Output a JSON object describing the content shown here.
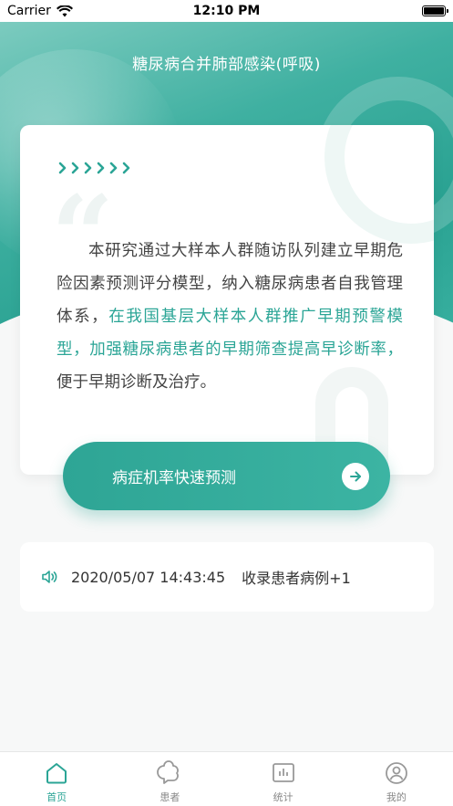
{
  "status_bar": {
    "carrier": "Carrier",
    "time": "12:10 PM"
  },
  "header": {
    "title": "糖尿病合并肺部感染(呼吸)"
  },
  "intro": {
    "chevrons": "››››››",
    "text_part1": "本研究通过大样本人群随访队列建立早期危险因素预测评分模型，纳入糖尿病患者自我管理体系，",
    "text_highlight": "在我国基层大样本人群推广早期预警模型，加强糖尿病患者的早期筛查提高早诊断率，",
    "text_part2": "便于早期诊断及治疗。"
  },
  "predict_button": {
    "label": "病症机率快速预测"
  },
  "notice": {
    "date": "2020/05/07 14:43:45",
    "message": "收录患者病例+1"
  },
  "tabs": [
    {
      "label": "首页",
      "icon": "home-icon",
      "active": true
    },
    {
      "label": "患者",
      "icon": "patient-icon",
      "active": false
    },
    {
      "label": "统计",
      "icon": "stats-icon",
      "active": false
    },
    {
      "label": "我的",
      "icon": "profile-icon",
      "active": false
    }
  ],
  "colors": {
    "accent": "#2ba596",
    "inactive": "#888888"
  }
}
